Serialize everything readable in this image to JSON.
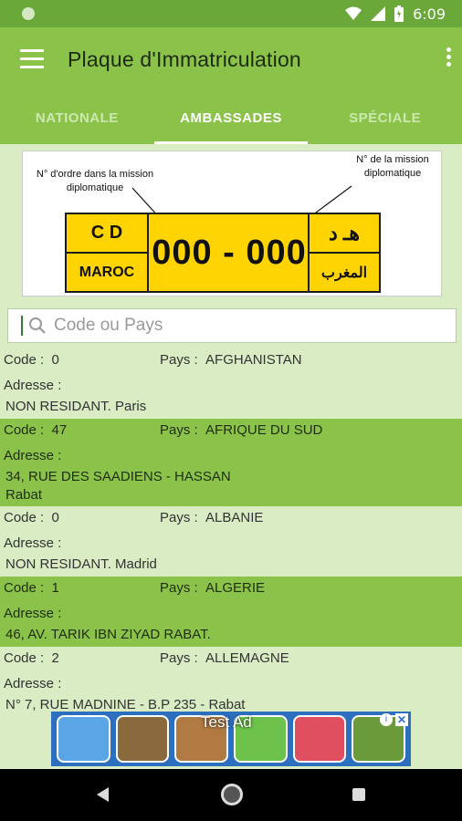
{
  "status_bar": {
    "time": "6:09",
    "icons": [
      "wifi-icon",
      "signal-icon",
      "battery-icon"
    ]
  },
  "app_bar": {
    "title": "Plaque d'Immatriculation",
    "menu_icon": "hamburger-icon",
    "more_icon": "more-vert-icon"
  },
  "tabs": [
    {
      "label": "NATIONALE",
      "active": false
    },
    {
      "label": "AMBASSADES",
      "active": true
    },
    {
      "label": "SPÉCIALE",
      "active": false
    }
  ],
  "plate_diagram": {
    "note_left": "N° d'ordre dans la mission diplomatique",
    "note_right": "N° de la mission diplomatique",
    "cd": "C D",
    "maroc": "MAROC",
    "number": "000 - 000",
    "arabic_top": "هـ د",
    "arabic_bottom": "المغرب"
  },
  "search": {
    "placeholder": "Code ou Pays"
  },
  "list_labels": {
    "code": "Code :",
    "pays": "Pays :",
    "adresse": "Adresse :"
  },
  "list": [
    {
      "code": "0",
      "pays": "AFGHANISTAN",
      "adresse": "NON RESIDANT.  Paris"
    },
    {
      "code": "47",
      "pays": "AFRIQUE DU SUD",
      "adresse": "34, RUE DES SAADIENS - HASSAN\nRabat"
    },
    {
      "code": "0",
      "pays": "ALBANIE",
      "adresse": "NON RESIDANT. Madrid"
    },
    {
      "code": "1",
      "pays": "ALGERIE",
      "adresse": "46, AV. TARIK IBN ZIYAD RABAT."
    },
    {
      "code": "2",
      "pays": "ALLEMAGNE",
      "adresse": "N° 7, RUE MADNINE - B.P 235 - Rabat"
    }
  ],
  "ad": {
    "label": "Test Ad"
  },
  "colors": {
    "primary": "#8bc34a",
    "primary_dark": "#6aa83a",
    "row_light": "#d9ecc4",
    "plate": "#ffd400"
  }
}
